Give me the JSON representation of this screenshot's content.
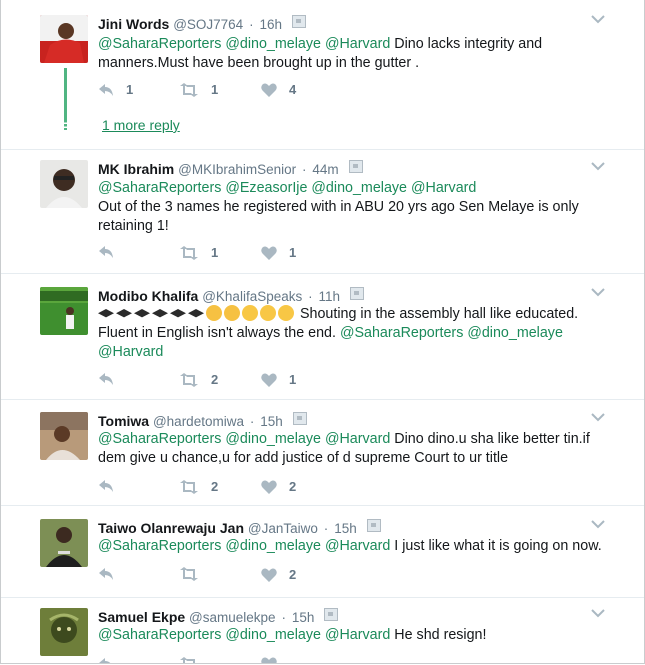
{
  "colors": {
    "mention": "#1b8a5a",
    "meta": "#657786",
    "thread": "#50b582"
  },
  "tweets": [
    {
      "name": "Jini Words",
      "handle": "@SOJ7764",
      "time": "16h",
      "mentions": [
        "@SaharaReporters",
        "@dino_melaye",
        "@Harvard"
      ],
      "text": " Dino lacks integrity and manners.Must have been brought up in the gutter .",
      "reply": "1",
      "retweet": "1",
      "like": "4",
      "more_replies": "1 more reply"
    },
    {
      "name": "MK Ibrahim",
      "handle": "@MKIbrahimSenior",
      "time": "44m",
      "mentions": [
        "@SaharaReporters",
        "@EzeasorIje",
        "@dino_melaye",
        "@Harvard"
      ],
      "text": "Out of the 3 names he registered with in ABU 20 yrs ago Sen Melaye is only retaining 1!",
      "reply": "",
      "retweet": "1",
      "like": "1"
    },
    {
      "name": "Modibo Khalifa",
      "handle": "@KhalifaSpeaks",
      "time": "11h",
      "mentions": [
        "@SaharaReporters",
        "@dino_melaye",
        "@Harvard"
      ],
      "text": "Shouting in the assembly hall like educated. Fluent in English isn't always the end.",
      "reply": "",
      "retweet": "2",
      "like": "1"
    },
    {
      "name": "Tomiwa",
      "handle": "@hardetomiwa",
      "time": "15h",
      "mentions": [
        "@SaharaReporters",
        "@dino_melaye",
        "@Harvard"
      ],
      "text": " Dino dino.u sha like better tin.if dem give u chance,u for add justice of d supreme Court to ur title",
      "reply": "",
      "retweet": "2",
      "like": "2"
    },
    {
      "name": "Taiwo Olanrewaju Jan",
      "handle": "@JanTaiwo",
      "time": "15h",
      "mentions": [
        "@SaharaReporters",
        "@dino_melaye",
        "@Harvard"
      ],
      "text": " I just like what it is going on now.",
      "reply": "",
      "retweet": "",
      "like": "2"
    },
    {
      "name": "Samuel Ekpe",
      "handle": "@samuelekpe",
      "time": "15h",
      "mentions": [
        "@SaharaReporters",
        "@dino_melaye",
        "@Harvard"
      ],
      "text": " He shd resign!",
      "reply": "",
      "retweet": "",
      "like": ""
    }
  ]
}
